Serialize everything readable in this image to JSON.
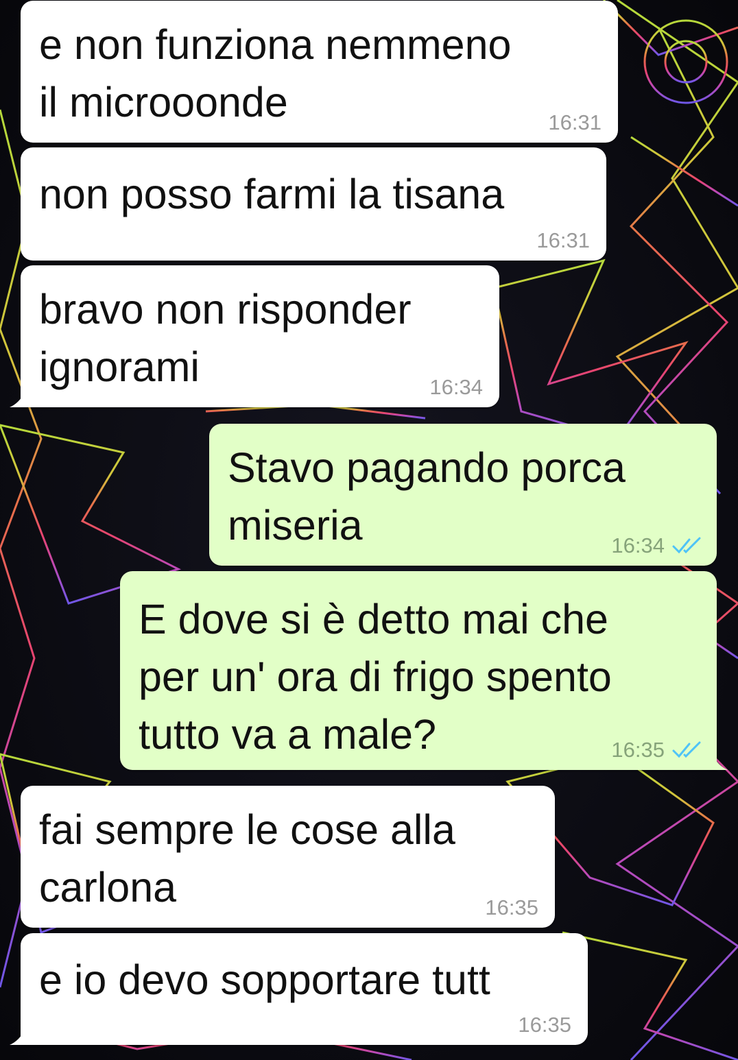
{
  "colors": {
    "incoming_bubble": "#ffffff",
    "outgoing_bubble": "#e2ffc7",
    "timestamp": "#9a9a9a",
    "read_ticks": "#4fc3f7"
  },
  "messages": [
    {
      "direction": "incoming",
      "text": "e non funziona nemmeno\nil microoonde",
      "time": "16:31"
    },
    {
      "direction": "incoming",
      "text": "non posso farmi la tisana",
      "time": "16:31"
    },
    {
      "direction": "incoming",
      "text": "bravo non risponder\nignorami",
      "time": "16:34"
    },
    {
      "direction": "outgoing",
      "text": "Stavo pagando porca\nmiseria",
      "time": "16:34",
      "status_icon": "double-check-icon"
    },
    {
      "direction": "outgoing",
      "text": "E dove si è detto mai che\nper un' ora di frigo spento\ntutto va a male?",
      "time": "16:35",
      "status_icon": "double-check-icon"
    },
    {
      "direction": "incoming",
      "text": "fai sempre le cose alla\ncarlona",
      "time": "16:35"
    },
    {
      "direction": "incoming",
      "text": "e io devo sopportare tutt",
      "time": "16:35"
    }
  ]
}
